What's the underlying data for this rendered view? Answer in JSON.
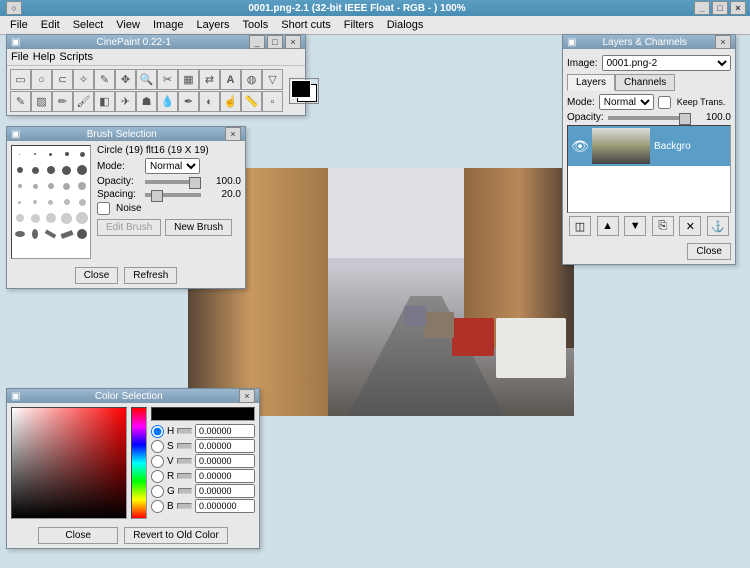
{
  "window": {
    "title": "0001.png-2.1 (32-bit IEEE Float - RGB - ) 100%"
  },
  "main_menu": [
    "File",
    "Edit",
    "Select",
    "View",
    "Image",
    "Layers",
    "Tools",
    "Short cuts",
    "Filters",
    "Dialogs"
  ],
  "toolbox": {
    "title": "CinePaint 0.22-1",
    "menu": [
      "File",
      "Help",
      "Scripts"
    ]
  },
  "brush": {
    "title": "Brush Selection",
    "name": "Circle (19) flt16  (19 X 19)",
    "mode_label": "Mode:",
    "mode": "Normal",
    "opacity_label": "Opacity:",
    "opacity": "100.0",
    "spacing_label": "Spacing:",
    "spacing": "20.0",
    "noise_label": "Noise",
    "edit": "Edit Brush",
    "new": "New Brush",
    "close": "Close",
    "refresh": "Refresh"
  },
  "color": {
    "title": "Color Selection",
    "channels": [
      "H",
      "S",
      "V",
      "R",
      "G",
      "B"
    ],
    "valH": "0.00000",
    "valS": "0.00000",
    "valV": "0.00000",
    "valR": "0.00000",
    "valG": "0.00000",
    "valB": "0.000000",
    "close": "Close",
    "revert": "Revert to Old Color"
  },
  "layers": {
    "title": "Layers & Channels",
    "image_label": "Image:",
    "image": "0001.png-2",
    "tab_layers": "Layers",
    "tab_channels": "Channels",
    "mode_label": "Mode:",
    "mode": "Normal",
    "keep_trans": "Keep Trans.",
    "opacity_label": "Opacity:",
    "opacity": "100.0",
    "layer_name": "Backgro",
    "close": "Close"
  }
}
